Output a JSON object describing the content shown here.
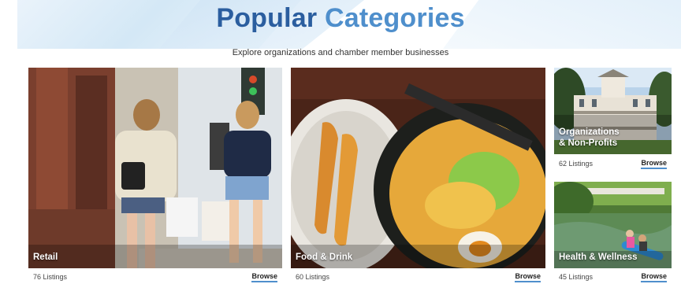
{
  "header": {
    "title_word1": "Popular",
    "title_word2": "Categories",
    "subtitle": "Explore organizations and chamber member businesses"
  },
  "categories": [
    {
      "name": "Retail",
      "listings": "76 Listings",
      "action": "Browse"
    },
    {
      "name": "Food & Drink",
      "listings": "60 Listings",
      "action": "Browse"
    },
    {
      "name_line1": "Organizations",
      "name_line2": "& Non-Profits",
      "listings": "62 Listings",
      "action": "Browse"
    },
    {
      "name": "Health & Wellness",
      "listings": "45 Listings",
      "action": "Browse"
    }
  ],
  "colors": {
    "title_dark": "#2b5e9f",
    "title_light": "#4f8fcc",
    "accent": "#4f8fcc"
  }
}
